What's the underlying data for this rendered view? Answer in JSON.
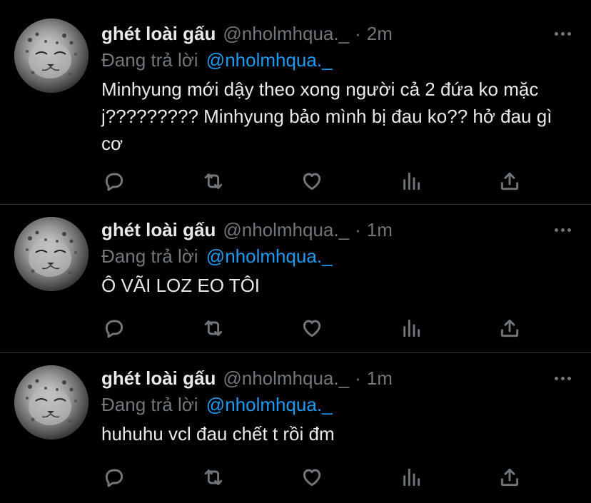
{
  "colors": {
    "background": "#000000",
    "text": "#e7e9ea",
    "muted": "#71767b",
    "link": "#1d9bf0",
    "divider": "#2f3336"
  },
  "tweets": [
    {
      "display_name": "ghét loài gấu",
      "handle": "@nholmhqua._",
      "separator": "·",
      "time": "2m",
      "replying_label": "Đang trả lời",
      "replying_to": "@nholmhqua._",
      "text": "Minhyung mới dậy theo xong người cả 2 đứa ko mặc j????????? Minhyung bảo mình bị đau ko?? hở đau gì cơ",
      "avatar_icon": "snow-leopard-avatar",
      "actions": [
        "reply-icon",
        "retweet-icon",
        "like-icon",
        "analytics-icon",
        "share-icon"
      ]
    },
    {
      "display_name": "ghét loài gấu",
      "handle": "@nholmhqua._",
      "separator": "·",
      "time": "1m",
      "replying_label": "Đang trả lời",
      "replying_to": "@nholmhqua._",
      "text": "Ô VÃI LOZ EO TÔI",
      "avatar_icon": "snow-leopard-avatar",
      "actions": [
        "reply-icon",
        "retweet-icon",
        "like-icon",
        "analytics-icon",
        "share-icon"
      ]
    },
    {
      "display_name": "ghét loài gấu",
      "handle": "@nholmhqua._",
      "separator": "·",
      "time": "1m",
      "replying_label": "Đang trả lời",
      "replying_to": "@nholmhqua._",
      "text": "huhuhu vcl đau chết t rồi đm",
      "avatar_icon": "snow-leopard-avatar",
      "actions": [
        "reply-icon",
        "retweet-icon",
        "like-icon",
        "analytics-icon",
        "share-icon"
      ]
    }
  ]
}
